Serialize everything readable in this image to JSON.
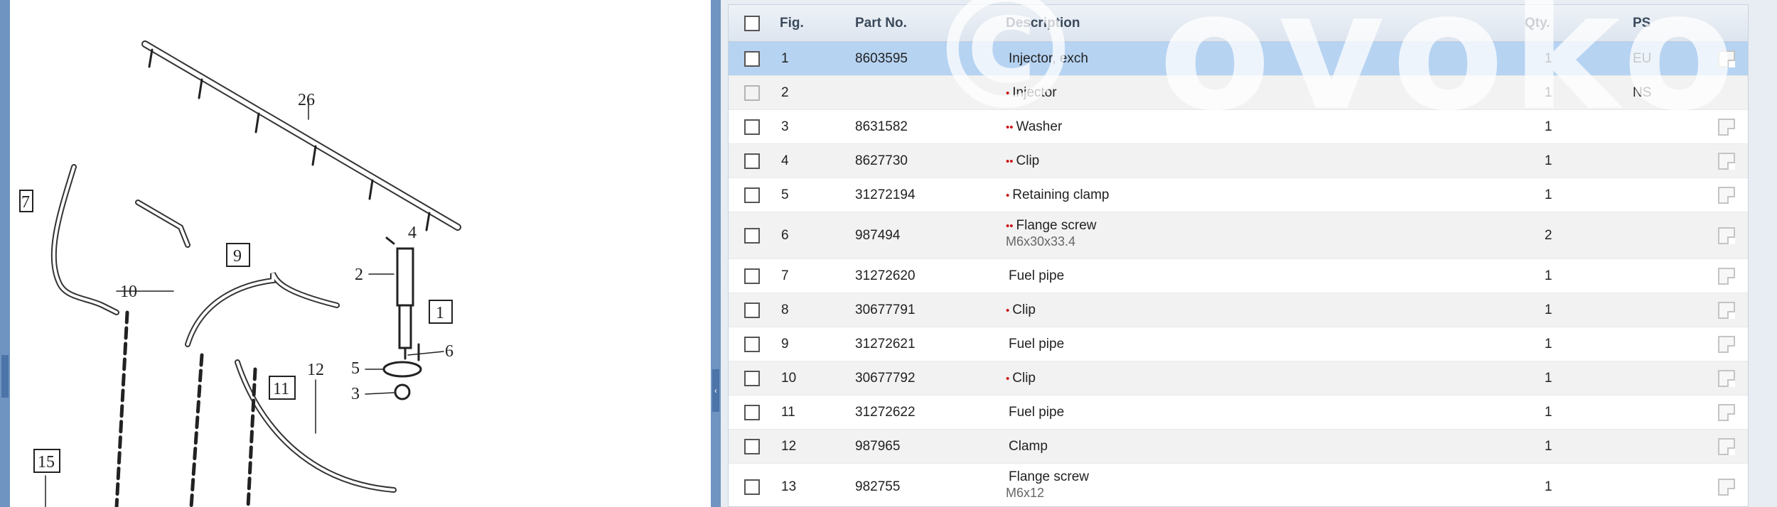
{
  "diagram": {
    "labels": [
      "26",
      "7",
      "4",
      "2",
      "1",
      "9",
      "10",
      "6",
      "5",
      "3",
      "12",
      "11",
      "15"
    ]
  },
  "table": {
    "headers": {
      "fig": "Fig.",
      "part_no": "Part No.",
      "description": "Description",
      "qty": "Qty.",
      "ps": "PS"
    },
    "rows": [
      {
        "fig": "1",
        "part_no": "8603595",
        "dots": "",
        "desc": "Injector, exch",
        "sub": "",
        "qty": "1",
        "ps": "EU"
      },
      {
        "fig": "2",
        "part_no": "",
        "dots": "•",
        "desc": "Injector",
        "sub": "",
        "qty": "1",
        "ps": "NS"
      },
      {
        "fig": "3",
        "part_no": "8631582",
        "dots": "••",
        "desc": "Washer",
        "sub": "",
        "qty": "1",
        "ps": ""
      },
      {
        "fig": "4",
        "part_no": "8627730",
        "dots": "••",
        "desc": "Clip",
        "sub": "",
        "qty": "1",
        "ps": ""
      },
      {
        "fig": "5",
        "part_no": "31272194",
        "dots": "•",
        "desc": "Retaining clamp",
        "sub": "",
        "qty": "1",
        "ps": ""
      },
      {
        "fig": "6",
        "part_no": "987494",
        "dots": "••",
        "desc": "Flange screw",
        "sub": "M6x30x33.4",
        "qty": "2",
        "ps": ""
      },
      {
        "fig": "7",
        "part_no": "31272620",
        "dots": "",
        "desc": "Fuel pipe",
        "sub": "",
        "qty": "1",
        "ps": ""
      },
      {
        "fig": "8",
        "part_no": "30677791",
        "dots": "•",
        "desc": "Clip",
        "sub": "",
        "qty": "1",
        "ps": ""
      },
      {
        "fig": "9",
        "part_no": "31272621",
        "dots": "",
        "desc": "Fuel pipe",
        "sub": "",
        "qty": "1",
        "ps": ""
      },
      {
        "fig": "10",
        "part_no": "30677792",
        "dots": "•",
        "desc": "Clip",
        "sub": "",
        "qty": "1",
        "ps": ""
      },
      {
        "fig": "11",
        "part_no": "31272622",
        "dots": "",
        "desc": "Fuel pipe",
        "sub": "",
        "qty": "1",
        "ps": ""
      },
      {
        "fig": "12",
        "part_no": "987965",
        "dots": "",
        "desc": "Clamp",
        "sub": "",
        "qty": "1",
        "ps": ""
      },
      {
        "fig": "13",
        "part_no": "982755",
        "dots": "",
        "desc": "Flange screw",
        "sub": "M6x12",
        "qty": "1",
        "ps": ""
      }
    ]
  },
  "watermark": {
    "text": "© ovoko"
  },
  "colors": {
    "selected_row": "#b6d3f2",
    "splitter": "#6f94c1",
    "bullet": "#cc1111"
  }
}
